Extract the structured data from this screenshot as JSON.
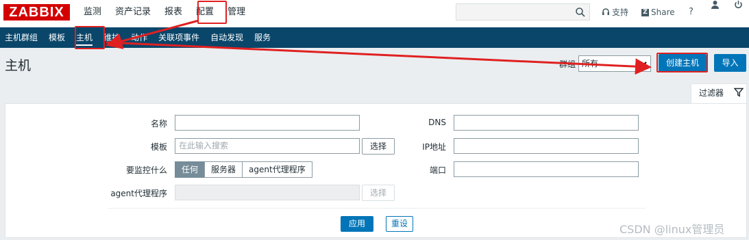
{
  "logo": "ZABBIX",
  "top_menu": [
    "监测",
    "资产记录",
    "报表",
    "配置",
    "管理"
  ],
  "top_right": {
    "support": "支持",
    "share": "Share",
    "help": "?"
  },
  "sub_menu": [
    "主机群组",
    "模板",
    "主机",
    "维护",
    "动作",
    "关联项事件",
    "自动发现",
    "服务"
  ],
  "page": {
    "title": "主机",
    "group_label": "群组",
    "group_value": "所有",
    "create_button": "创建主机",
    "import_button": "导入"
  },
  "filter": {
    "tab_label": "过滤器",
    "name_label": "名称",
    "name_value": "",
    "template_label": "模板",
    "template_placeholder": "在此输入搜索",
    "select_button": "选择",
    "monitor_label": "要监控什么",
    "monitor_options": [
      "任何",
      "服务器",
      "agent代理程序"
    ],
    "monitor_selected": "任何",
    "proxy_label": "agent代理程序",
    "proxy_select_button": "选择",
    "dns_label": "DNS",
    "ip_label": "IP地址",
    "port_label": "端口",
    "apply_button": "应用",
    "reset_button": "重设"
  },
  "watermark": "CSDN @linux管理员",
  "colors": {
    "brand_red": "#d40000",
    "nav_blue": "#0a466a",
    "button_blue": "#0275b8",
    "annotation_red": "#e02020"
  }
}
